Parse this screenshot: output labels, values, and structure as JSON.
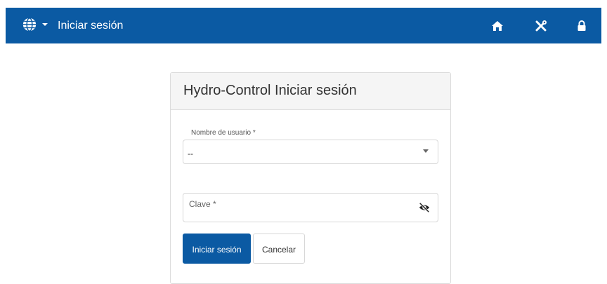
{
  "navbar": {
    "title": "Iniciar sesión",
    "language_icon": "globe-icon",
    "dropdown_icon": "caret-down-icon",
    "home_icon": "home-icon",
    "tools_icon": "tools-icon",
    "lock_icon": "lock-icon",
    "background_color": "#0b5aa3"
  },
  "login_card": {
    "title": "Hydro-Control Iniciar sesión",
    "username": {
      "label": "Nombre de usuario *",
      "selected_value": "--"
    },
    "password": {
      "placeholder": "Clave *",
      "visibility_icon": "eye-slash-icon"
    },
    "buttons": {
      "submit_label": "Iniciar sesión",
      "cancel_label": "Cancelar"
    },
    "accent_color": "#0b5aa3"
  }
}
